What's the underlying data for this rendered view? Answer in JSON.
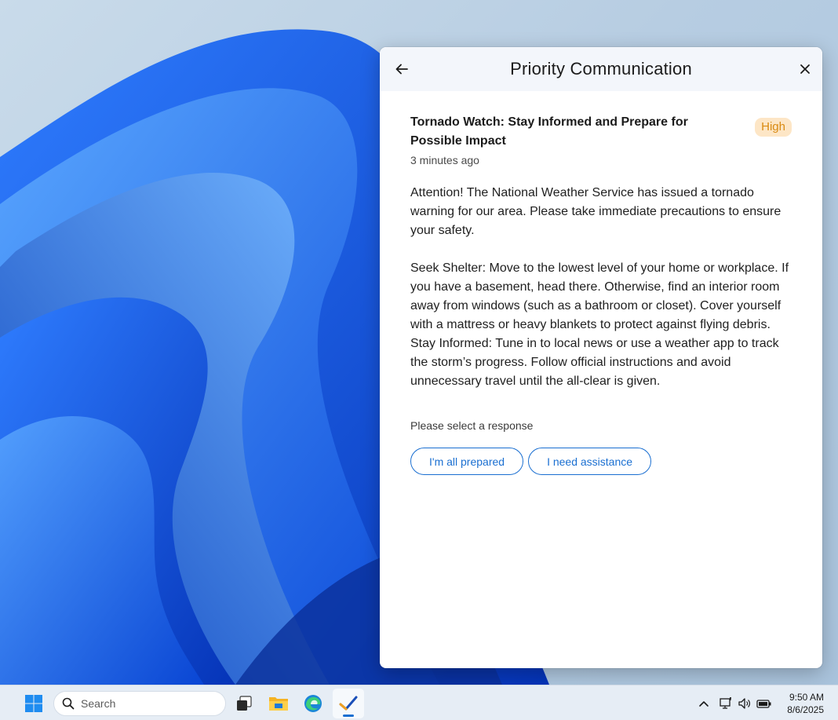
{
  "window": {
    "title": "Priority Communication",
    "back_icon": "arrow-left-icon",
    "close_icon": "close-icon"
  },
  "message": {
    "title": "Tornado Watch: Stay Informed and Prepare for Possible Impact",
    "priority": "High",
    "timestamp": "3 minutes ago",
    "paragraphs": [
      "Attention! The National Weather Service has issued a tornado warning for our area. Please take immediate precautions to ensure your safety.",
      "Seek Shelter: Move to the lowest level of your home or workplace. If you have a basement, head there. Otherwise, find an interior room away from windows (such as a bathroom or closet). Cover yourself with a mattress or heavy blankets to protect against flying debris.",
      "Stay Informed: Tune in to local news or use a weather app to track the storm’s progress. Follow official instructions and avoid unnecessary travel until the all-clear is given."
    ]
  },
  "response": {
    "prompt": "Please select a response",
    "options": [
      "I'm all prepared",
      "I need assistance"
    ]
  },
  "colors": {
    "accent": "#1a6fd1",
    "badge_bg": "#fde6c6",
    "badge_text": "#d98a12"
  },
  "taskbar": {
    "search_placeholder": "Search",
    "time": "9:50 AM",
    "date": "8/6/2025",
    "icons": [
      "windows-start-icon",
      "search-icon",
      "task-view-icon",
      "file-explorer-icon",
      "edge-icon",
      "alert-app-icon",
      "chevron-up-icon",
      "network-icon",
      "volume-icon",
      "battery-icon"
    ]
  }
}
